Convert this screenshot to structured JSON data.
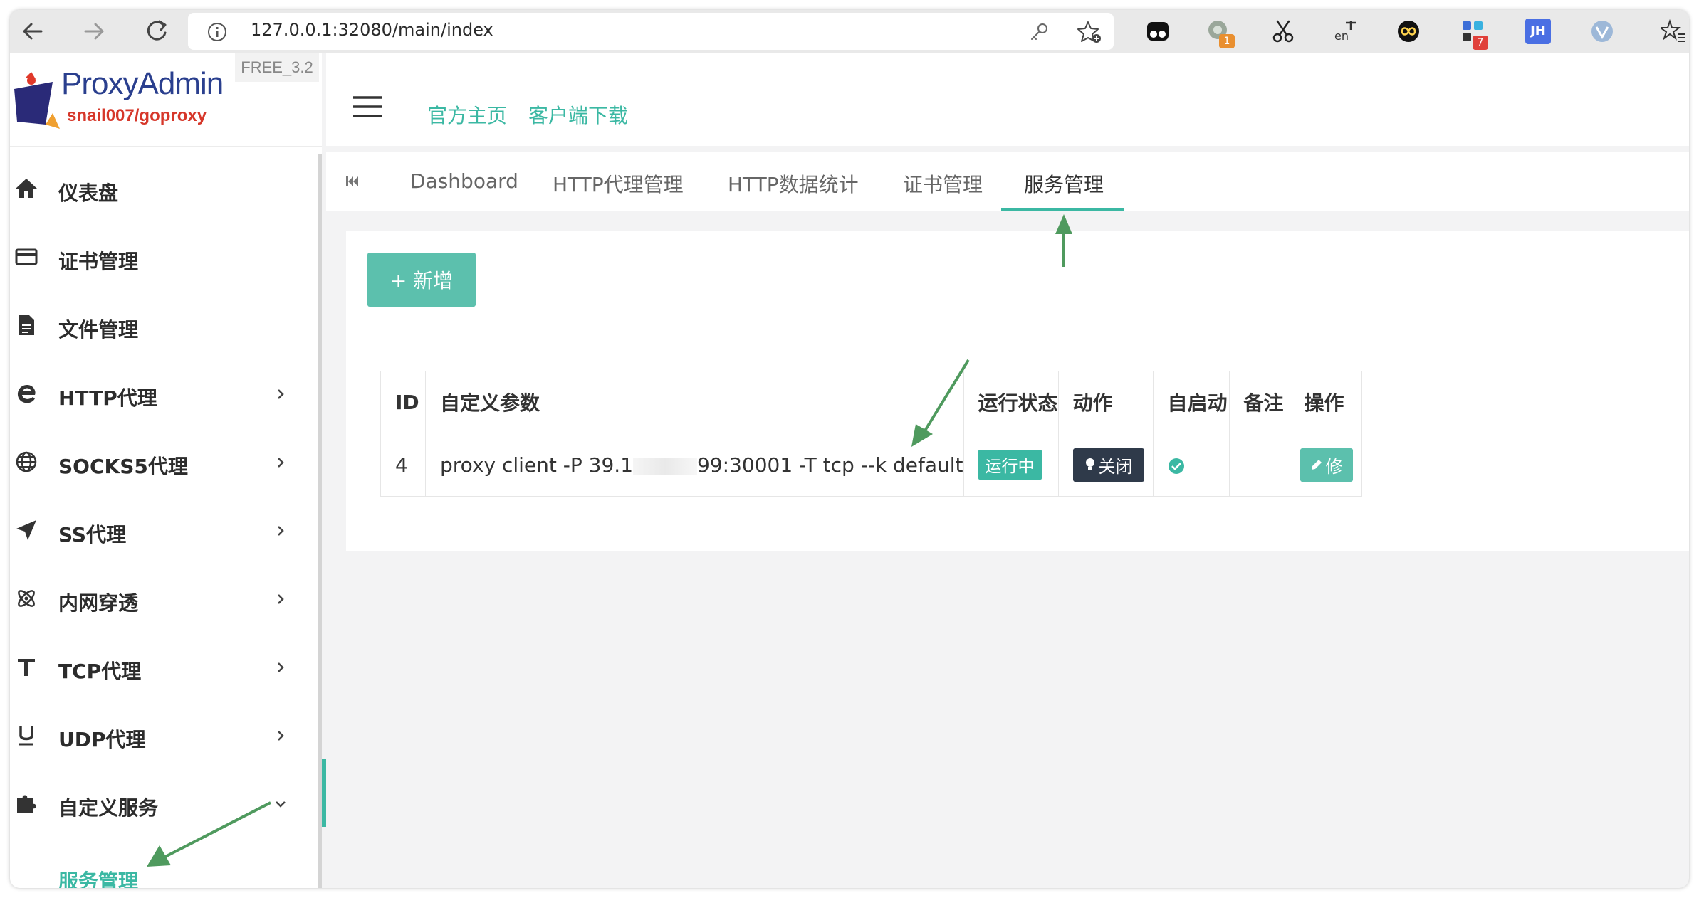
{
  "browser": {
    "url": "127.0.0.1:32080/main/index",
    "extension_badges": [
      "1",
      "7"
    ],
    "extension_labels": {
      "jh": "JH"
    }
  },
  "app": {
    "brand": "ProxyAdmin",
    "subtitle": "snail007/goproxy",
    "version": "FREE_3.2"
  },
  "sidebar": {
    "items": [
      {
        "label": "仪表盘",
        "icon": "home-icon"
      },
      {
        "label": "证书管理",
        "icon": "credit-card-icon"
      },
      {
        "label": "文件管理",
        "icon": "file-icon"
      },
      {
        "label": "HTTP代理",
        "icon": "edge-e-icon"
      },
      {
        "label": "SOCKS5代理",
        "icon": "globe-icon"
      },
      {
        "label": "SS代理",
        "icon": "paper-plane-icon"
      },
      {
        "label": "内网穿透",
        "icon": "atom-icon"
      },
      {
        "label": "TCP代理",
        "icon": "letter-t-icon"
      },
      {
        "label": "UDP代理",
        "icon": "letter-u-icon"
      },
      {
        "label": "自定义服务",
        "icon": "puzzle-icon"
      }
    ],
    "active_sub_item": "服务管理"
  },
  "topbar": {
    "links": [
      "官方主页",
      "客户端下载"
    ]
  },
  "tabs": {
    "items": [
      "Dashboard",
      "HTTP代理管理",
      "HTTP数据统计",
      "证书管理",
      "服务管理"
    ],
    "active_index": 4
  },
  "content": {
    "add_button": "+ 新增",
    "table": {
      "headers": [
        "ID",
        "自定义参数",
        "运行状态",
        "动作",
        "自启动",
        "备注",
        "操作"
      ],
      "rows": [
        {
          "id": "4",
          "params_prefix": "proxy client -P 39.1",
          "params_suffix": "99:30001 -T tcp --k default",
          "status": "运行中",
          "action": "关闭",
          "autostart": true,
          "note": "",
          "op": "修"
        }
      ]
    }
  },
  "colors": {
    "accent": "#3bb8a3",
    "button_green": "#5cc0ad",
    "dark_button": "#2f3a4a",
    "brand_blue": "#2a3f8e",
    "brand_red": "#d6372a",
    "arrow_green": "#4f9a5e"
  }
}
